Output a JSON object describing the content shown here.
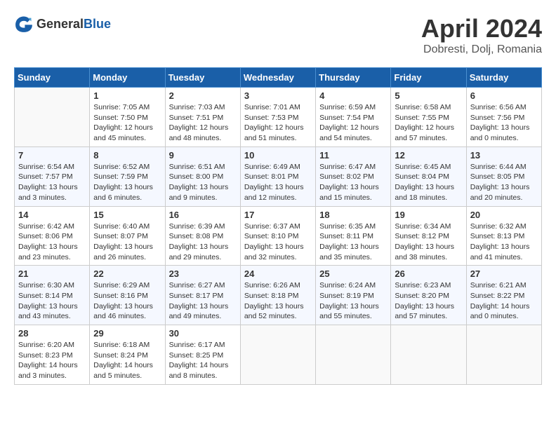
{
  "header": {
    "logo_general": "General",
    "logo_blue": "Blue",
    "month_title": "April 2024",
    "location": "Dobresti, Dolj, Romania"
  },
  "days_of_week": [
    "Sunday",
    "Monday",
    "Tuesday",
    "Wednesday",
    "Thursday",
    "Friday",
    "Saturday"
  ],
  "weeks": [
    [
      {
        "day": "",
        "sunrise": "",
        "sunset": "",
        "daylight": ""
      },
      {
        "day": "1",
        "sunrise": "Sunrise: 7:05 AM",
        "sunset": "Sunset: 7:50 PM",
        "daylight": "Daylight: 12 hours and 45 minutes."
      },
      {
        "day": "2",
        "sunrise": "Sunrise: 7:03 AM",
        "sunset": "Sunset: 7:51 PM",
        "daylight": "Daylight: 12 hours and 48 minutes."
      },
      {
        "day": "3",
        "sunrise": "Sunrise: 7:01 AM",
        "sunset": "Sunset: 7:53 PM",
        "daylight": "Daylight: 12 hours and 51 minutes."
      },
      {
        "day": "4",
        "sunrise": "Sunrise: 6:59 AM",
        "sunset": "Sunset: 7:54 PM",
        "daylight": "Daylight: 12 hours and 54 minutes."
      },
      {
        "day": "5",
        "sunrise": "Sunrise: 6:58 AM",
        "sunset": "Sunset: 7:55 PM",
        "daylight": "Daylight: 12 hours and 57 minutes."
      },
      {
        "day": "6",
        "sunrise": "Sunrise: 6:56 AM",
        "sunset": "Sunset: 7:56 PM",
        "daylight": "Daylight: 13 hours and 0 minutes."
      }
    ],
    [
      {
        "day": "7",
        "sunrise": "Sunrise: 6:54 AM",
        "sunset": "Sunset: 7:57 PM",
        "daylight": "Daylight: 13 hours and 3 minutes."
      },
      {
        "day": "8",
        "sunrise": "Sunrise: 6:52 AM",
        "sunset": "Sunset: 7:59 PM",
        "daylight": "Daylight: 13 hours and 6 minutes."
      },
      {
        "day": "9",
        "sunrise": "Sunrise: 6:51 AM",
        "sunset": "Sunset: 8:00 PM",
        "daylight": "Daylight: 13 hours and 9 minutes."
      },
      {
        "day": "10",
        "sunrise": "Sunrise: 6:49 AM",
        "sunset": "Sunset: 8:01 PM",
        "daylight": "Daylight: 13 hours and 12 minutes."
      },
      {
        "day": "11",
        "sunrise": "Sunrise: 6:47 AM",
        "sunset": "Sunset: 8:02 PM",
        "daylight": "Daylight: 13 hours and 15 minutes."
      },
      {
        "day": "12",
        "sunrise": "Sunrise: 6:45 AM",
        "sunset": "Sunset: 8:04 PM",
        "daylight": "Daylight: 13 hours and 18 minutes."
      },
      {
        "day": "13",
        "sunrise": "Sunrise: 6:44 AM",
        "sunset": "Sunset: 8:05 PM",
        "daylight": "Daylight: 13 hours and 20 minutes."
      }
    ],
    [
      {
        "day": "14",
        "sunrise": "Sunrise: 6:42 AM",
        "sunset": "Sunset: 8:06 PM",
        "daylight": "Daylight: 13 hours and 23 minutes."
      },
      {
        "day": "15",
        "sunrise": "Sunrise: 6:40 AM",
        "sunset": "Sunset: 8:07 PM",
        "daylight": "Daylight: 13 hours and 26 minutes."
      },
      {
        "day": "16",
        "sunrise": "Sunrise: 6:39 AM",
        "sunset": "Sunset: 8:08 PM",
        "daylight": "Daylight: 13 hours and 29 minutes."
      },
      {
        "day": "17",
        "sunrise": "Sunrise: 6:37 AM",
        "sunset": "Sunset: 8:10 PM",
        "daylight": "Daylight: 13 hours and 32 minutes."
      },
      {
        "day": "18",
        "sunrise": "Sunrise: 6:35 AM",
        "sunset": "Sunset: 8:11 PM",
        "daylight": "Daylight: 13 hours and 35 minutes."
      },
      {
        "day": "19",
        "sunrise": "Sunrise: 6:34 AM",
        "sunset": "Sunset: 8:12 PM",
        "daylight": "Daylight: 13 hours and 38 minutes."
      },
      {
        "day": "20",
        "sunrise": "Sunrise: 6:32 AM",
        "sunset": "Sunset: 8:13 PM",
        "daylight": "Daylight: 13 hours and 41 minutes."
      }
    ],
    [
      {
        "day": "21",
        "sunrise": "Sunrise: 6:30 AM",
        "sunset": "Sunset: 8:14 PM",
        "daylight": "Daylight: 13 hours and 43 minutes."
      },
      {
        "day": "22",
        "sunrise": "Sunrise: 6:29 AM",
        "sunset": "Sunset: 8:16 PM",
        "daylight": "Daylight: 13 hours and 46 minutes."
      },
      {
        "day": "23",
        "sunrise": "Sunrise: 6:27 AM",
        "sunset": "Sunset: 8:17 PM",
        "daylight": "Daylight: 13 hours and 49 minutes."
      },
      {
        "day": "24",
        "sunrise": "Sunrise: 6:26 AM",
        "sunset": "Sunset: 8:18 PM",
        "daylight": "Daylight: 13 hours and 52 minutes."
      },
      {
        "day": "25",
        "sunrise": "Sunrise: 6:24 AM",
        "sunset": "Sunset: 8:19 PM",
        "daylight": "Daylight: 13 hours and 55 minutes."
      },
      {
        "day": "26",
        "sunrise": "Sunrise: 6:23 AM",
        "sunset": "Sunset: 8:20 PM",
        "daylight": "Daylight: 13 hours and 57 minutes."
      },
      {
        "day": "27",
        "sunrise": "Sunrise: 6:21 AM",
        "sunset": "Sunset: 8:22 PM",
        "daylight": "Daylight: 14 hours and 0 minutes."
      }
    ],
    [
      {
        "day": "28",
        "sunrise": "Sunrise: 6:20 AM",
        "sunset": "Sunset: 8:23 PM",
        "daylight": "Daylight: 14 hours and 3 minutes."
      },
      {
        "day": "29",
        "sunrise": "Sunrise: 6:18 AM",
        "sunset": "Sunset: 8:24 PM",
        "daylight": "Daylight: 14 hours and 5 minutes."
      },
      {
        "day": "30",
        "sunrise": "Sunrise: 6:17 AM",
        "sunset": "Sunset: 8:25 PM",
        "daylight": "Daylight: 14 hours and 8 minutes."
      },
      {
        "day": "",
        "sunrise": "",
        "sunset": "",
        "daylight": ""
      },
      {
        "day": "",
        "sunrise": "",
        "sunset": "",
        "daylight": ""
      },
      {
        "day": "",
        "sunrise": "",
        "sunset": "",
        "daylight": ""
      },
      {
        "day": "",
        "sunrise": "",
        "sunset": "",
        "daylight": ""
      }
    ]
  ]
}
